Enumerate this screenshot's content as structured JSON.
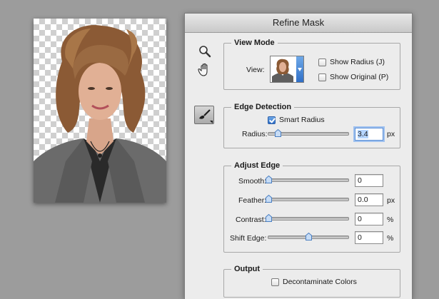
{
  "dialog": {
    "title": "Refine Mask"
  },
  "tools": {
    "zoom_icon": "magnifier-icon",
    "hand_icon": "hand-icon",
    "brush_icon": "refine-radius-brush-icon"
  },
  "view_mode": {
    "title": "View Mode",
    "view_label": "View:",
    "show_radius": {
      "label": "Show Radius (J)",
      "checked": false
    },
    "show_original": {
      "label": "Show Original (P)",
      "checked": false
    }
  },
  "edge_detection": {
    "title": "Edge Detection",
    "smart_radius": {
      "label": "Smart Radius",
      "checked": true
    },
    "radius": {
      "label": "Radius:",
      "value": "3.4",
      "unit": "px",
      "level": 0.12
    }
  },
  "adjust_edge": {
    "title": "Adjust Edge",
    "rows": [
      {
        "label": "Smooth:",
        "value": "0",
        "unit": "",
        "level": 0.0
      },
      {
        "label": "Feather:",
        "value": "0.0",
        "unit": "px",
        "level": 0.0
      },
      {
        "label": "Contrast:",
        "value": "0",
        "unit": "%",
        "level": 0.0
      },
      {
        "label": "Shift Edge:",
        "value": "0",
        "unit": "%",
        "level": 0.5
      }
    ]
  },
  "output": {
    "title": "Output",
    "decontaminate": {
      "label": "Decontaminate Colors",
      "checked": false
    }
  },
  "colors": {
    "accent": "#2f6fc7",
    "dialog_bg": "#ececec",
    "workspace_bg": "#9c9c9c"
  }
}
